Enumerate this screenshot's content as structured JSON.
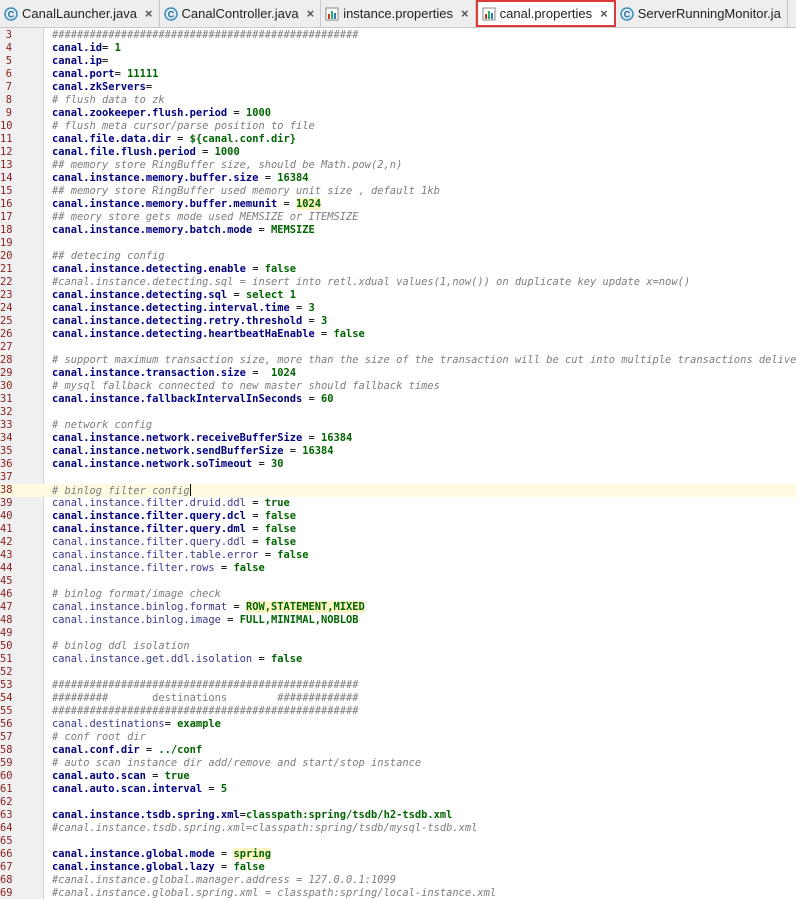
{
  "tabs": [
    {
      "label": "CanalLauncher.java",
      "icon": "java-class-icon",
      "close": "×",
      "active": false
    },
    {
      "label": "CanalController.java",
      "icon": "java-class-icon",
      "close": "×",
      "active": false
    },
    {
      "label": "instance.properties",
      "icon": "properties-file-icon",
      "close": "×",
      "active": false
    },
    {
      "label": "canal.properties",
      "icon": "properties-file-icon",
      "close": "×",
      "active": true
    },
    {
      "label": "ServerRunningMonitor.ja",
      "icon": "java-class-icon",
      "close": "",
      "active": false
    }
  ],
  "colors": {
    "key": "#000080",
    "value": "#006400",
    "comment": "#7d7d7d",
    "line_number": "#8a1e1e",
    "active_tab_border": "#dd3b3b"
  },
  "lines": [
    {
      "n": "3",
      "t": "h",
      "text": "#################################################"
    },
    {
      "n": "4",
      "t": "kv",
      "key": "canal.id",
      "bold": true,
      "sep": "= ",
      "val": "1"
    },
    {
      "n": "5",
      "t": "kv",
      "key": "canal.ip",
      "bold": true,
      "sep": "=",
      "val": ""
    },
    {
      "n": "6",
      "t": "kv",
      "key": "canal.port",
      "bold": true,
      "sep": "= ",
      "val": "11111"
    },
    {
      "n": "7",
      "t": "kv",
      "key": "canal.zkServers",
      "bold": true,
      "sep": "=",
      "val": ""
    },
    {
      "n": "8",
      "t": "c",
      "text": "# flush data to zk"
    },
    {
      "n": "9",
      "t": "kv",
      "key": "canal.zookeeper.flush.period",
      "bold": true,
      "sep": " = ",
      "val": "1000"
    },
    {
      "n": "10",
      "t": "c",
      "text": "# flush meta cursor/parse position to file"
    },
    {
      "n": "11",
      "t": "kv",
      "key": "canal.file.data.dir",
      "bold": true,
      "sep": " = ",
      "val": "${canal.conf.dir}"
    },
    {
      "n": "12",
      "t": "kv",
      "key": "canal.file.flush.period",
      "bold": true,
      "sep": " = ",
      "val": "1000"
    },
    {
      "n": "13",
      "t": "c",
      "text": "## memory store RingBuffer size, should be Math.pow(2,n)"
    },
    {
      "n": "14",
      "t": "kv",
      "key": "canal.instance.memory.buffer.size",
      "bold": true,
      "sep": " = ",
      "val": "16384"
    },
    {
      "n": "15",
      "t": "c",
      "text": "## memory store RingBuffer used memory unit size , default 1kb"
    },
    {
      "n": "16",
      "t": "kv",
      "key": "canal.instance.memory.buffer.memunit",
      "bold": true,
      "sep": " = ",
      "val": "1024",
      "hl": true
    },
    {
      "n": "17",
      "t": "c",
      "text": "## meory store gets mode used MEMSIZE or ITEMSIZE"
    },
    {
      "n": "18",
      "t": "kv",
      "key": "canal.instance.memory.batch.mode",
      "bold": true,
      "sep": " = ",
      "val": "MEMSIZE"
    },
    {
      "n": "19",
      "t": "blank"
    },
    {
      "n": "20",
      "t": "c",
      "text": "## detecing config"
    },
    {
      "n": "21",
      "t": "kv",
      "key": "canal.instance.detecting.enable",
      "bold": true,
      "sep": " = ",
      "val": "false"
    },
    {
      "n": "22",
      "t": "c",
      "text": "#canal.instance.detecting.sql = insert into retl.xdual values(1,now()) on duplicate key update x=now()"
    },
    {
      "n": "23",
      "t": "kv",
      "key": "canal.instance.detecting.sql",
      "bold": true,
      "sep": " = ",
      "val": "select 1"
    },
    {
      "n": "24",
      "t": "kv",
      "key": "canal.instance.detecting.interval.time",
      "bold": true,
      "sep": " = ",
      "val": "3"
    },
    {
      "n": "25",
      "t": "kv",
      "key": "canal.instance.detecting.retry.threshold",
      "bold": true,
      "sep": " = ",
      "val": "3"
    },
    {
      "n": "26",
      "t": "kv",
      "key": "canal.instance.detecting.heartbeatHaEnable",
      "bold": true,
      "sep": " = ",
      "val": "false"
    },
    {
      "n": "27",
      "t": "blank"
    },
    {
      "n": "28",
      "t": "c",
      "text": "# support maximum transaction size, more than the size of the transaction will be cut into multiple transactions delivery"
    },
    {
      "n": "29",
      "t": "kv",
      "key": "canal.instance.transaction.size",
      "bold": true,
      "sep": " =  ",
      "val": "1024"
    },
    {
      "n": "30",
      "t": "c",
      "text": "# mysql fallback connected to new master should fallback times"
    },
    {
      "n": "31",
      "t": "kv",
      "key": "canal.instance.fallbackIntervalInSeconds",
      "bold": true,
      "sep": " = ",
      "val": "60"
    },
    {
      "n": "32",
      "t": "blank"
    },
    {
      "n": "33",
      "t": "c",
      "text": "# network config"
    },
    {
      "n": "34",
      "t": "kv",
      "key": "canal.instance.network.receiveBufferSize",
      "bold": true,
      "sep": " = ",
      "val": "16384"
    },
    {
      "n": "35",
      "t": "kv",
      "key": "canal.instance.network.sendBufferSize",
      "bold": true,
      "sep": " = ",
      "val": "16384"
    },
    {
      "n": "36",
      "t": "kv",
      "key": "canal.instance.network.soTimeout",
      "bold": true,
      "sep": " = ",
      "val": "30"
    },
    {
      "n": "37",
      "t": "blank"
    },
    {
      "n": "38",
      "t": "c",
      "text": "# binlog filter config",
      "caret": true
    },
    {
      "n": "39",
      "t": "kv",
      "key": "canal.instance.filter.druid.ddl",
      "bold": false,
      "sep": " = ",
      "val": "true"
    },
    {
      "n": "40",
      "t": "kv",
      "key": "canal.instance.filter.query.dcl",
      "bold": true,
      "sep": " = ",
      "val": "false"
    },
    {
      "n": "41",
      "t": "kv",
      "key": "canal.instance.filter.query.dml",
      "bold": true,
      "sep": " = ",
      "val": "false"
    },
    {
      "n": "42",
      "t": "kv",
      "key": "canal.instance.filter.query.ddl",
      "bold": false,
      "sep": " = ",
      "val": "false"
    },
    {
      "n": "43",
      "t": "kv",
      "key": "canal.instance.filter.table.error",
      "bold": false,
      "sep": " = ",
      "val": "false"
    },
    {
      "n": "44",
      "t": "kv",
      "key": "canal.instance.filter.rows",
      "bold": false,
      "sep": " = ",
      "val": "false"
    },
    {
      "n": "45",
      "t": "blank"
    },
    {
      "n": "46",
      "t": "c",
      "text": "# binlog format/image check"
    },
    {
      "n": "47",
      "t": "kv",
      "key": "canal.instance.binlog.format",
      "bold": false,
      "sep": " = ",
      "val": "ROW,STATEMENT,MIXED",
      "hl": true
    },
    {
      "n": "48",
      "t": "kv",
      "key": "canal.instance.binlog.image",
      "bold": false,
      "sep": " = ",
      "val": "FULL,MINIMAL,NOBLOB"
    },
    {
      "n": "49",
      "t": "blank"
    },
    {
      "n": "50",
      "t": "c",
      "text": "# binlog ddl isolation"
    },
    {
      "n": "51",
      "t": "kv",
      "key": "canal.instance.get.ddl.isolation",
      "bold": false,
      "sep": " = ",
      "val": "false"
    },
    {
      "n": "52",
      "t": "blank"
    },
    {
      "n": "53",
      "t": "h",
      "text": "#################################################"
    },
    {
      "n": "54",
      "t": "h",
      "text": "#########       destinations        #############"
    },
    {
      "n": "55",
      "t": "h",
      "text": "#################################################"
    },
    {
      "n": "56",
      "t": "kv",
      "key": "canal.destinations",
      "bold": false,
      "sep": "= ",
      "val": "example"
    },
    {
      "n": "57",
      "t": "c",
      "text": "# conf root dir"
    },
    {
      "n": "58",
      "t": "kv",
      "key": "canal.conf.dir",
      "bold": true,
      "sep": " = ",
      "val": "../conf"
    },
    {
      "n": "59",
      "t": "c",
      "text": "# auto scan instance dir add/remove and start/stop instance"
    },
    {
      "n": "60",
      "t": "kv",
      "key": "canal.auto.scan",
      "bold": true,
      "sep": " = ",
      "val": "true"
    },
    {
      "n": "61",
      "t": "kv",
      "key": "canal.auto.scan.interval",
      "bold": true,
      "sep": " = ",
      "val": "5"
    },
    {
      "n": "62",
      "t": "blank"
    },
    {
      "n": "63",
      "t": "kv",
      "key": "canal.instance.tsdb.spring.xml",
      "bold": true,
      "sep": "=",
      "val": "classpath:spring/tsdb/h2-tsdb.xml"
    },
    {
      "n": "64",
      "t": "c",
      "text": "#canal.instance.tsdb.spring.xml=classpath:spring/tsdb/mysql-tsdb.xml"
    },
    {
      "n": "65",
      "t": "blank"
    },
    {
      "n": "66",
      "t": "kv",
      "key": "canal.instance.global.mode",
      "bold": true,
      "sep": " = ",
      "val": "spring",
      "hl": true
    },
    {
      "n": "67",
      "t": "kv",
      "key": "canal.instance.global.lazy",
      "bold": true,
      "sep": " = ",
      "val": "false"
    },
    {
      "n": "68",
      "t": "c",
      "text": "#canal.instance.global.manager.address = 127.0.0.1:1099"
    },
    {
      "n": "69",
      "t": "c",
      "text": "#canal.instance.global.spring.xml = classpath:spring/local-instance.xml"
    }
  ]
}
